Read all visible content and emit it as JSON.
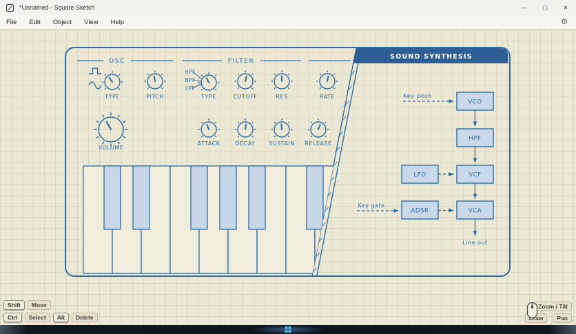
{
  "window": {
    "title": "*Unnamed - Square Sketch",
    "minimize": "—",
    "maximize": "▢",
    "close": "✕"
  },
  "menu": {
    "items": [
      {
        "label": "File"
      },
      {
        "label": "Edit"
      },
      {
        "label": "Object"
      },
      {
        "label": "View"
      },
      {
        "label": "Help"
      }
    ]
  },
  "canvas": {
    "panel": {
      "osc": {
        "title": "OSC",
        "knob1": "TYPE",
        "knob2": "PITCH"
      },
      "filter": {
        "title": "FILTER",
        "mode1": "HPF",
        "mode2": "BPF",
        "mode3": "LPF",
        "knob1": "TYPE",
        "knob2": "CUTOFF",
        "knob3": "RES"
      },
      "rate_label": "RATE",
      "volume_label": "VOLUME",
      "env": {
        "a": "ATTACK",
        "d": "DECAY",
        "s": "SUSTAIN",
        "r": "RELEASE"
      }
    },
    "diagram": {
      "title": "SOUND SYNTHESIS",
      "key_pitch": "Key pitch",
      "key_gate": "Key gate",
      "vco": "VCO",
      "hpf": "HPF",
      "lfo": "LFO",
      "vcf": "VCF",
      "adsr": "ADSR",
      "vca": "VCA",
      "line_out": "Line out"
    }
  },
  "hints": {
    "shift_key": "Shift",
    "shift_action": "Move",
    "ctrl_key": "Ctrl",
    "ctrl_action": "Select",
    "alt_key": "Alt",
    "alt_action": "Delete",
    "zoom_tilt": "Zoom / Tilt",
    "draw": "Draw",
    "pan": "Pan"
  },
  "colors": {
    "ink": "#2e6da4",
    "block_fill": "#c9d9e9",
    "header_fill": "#2d5e95",
    "paper": "#ece8d6",
    "taskbar": "#0d131c",
    "accent": "#56b9e8"
  }
}
